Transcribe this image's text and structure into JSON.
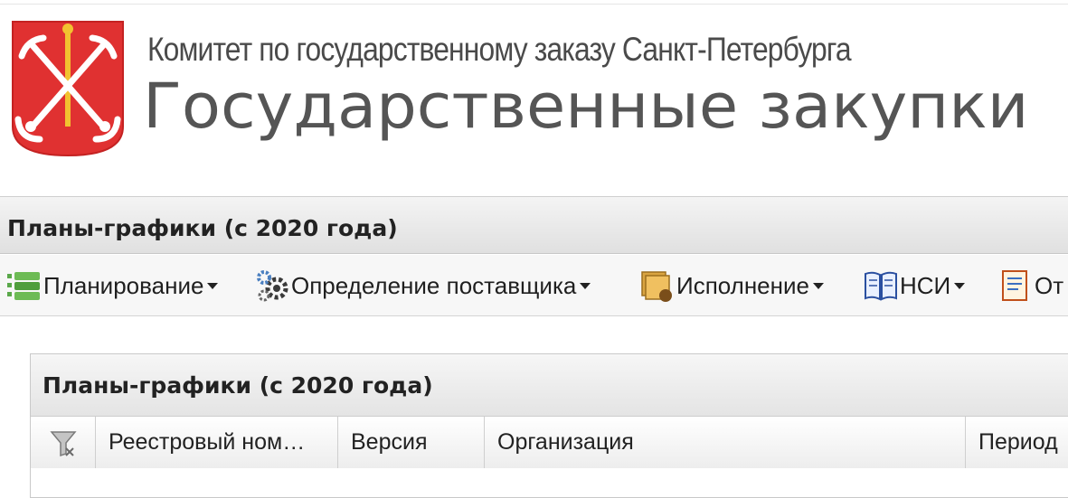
{
  "header": {
    "org_name": "Комитет по государственному заказу Санкт-Петербурга",
    "site_title": "Государственные закупки",
    "emblem": "saint-petersburg-coat-of-arms"
  },
  "section": {
    "title": "Планы-графики (с 2020 года)"
  },
  "menu": {
    "items": [
      {
        "label": "Планирование",
        "icon": "planning-icon"
      },
      {
        "label": "Определение поставщика",
        "icon": "gears-icon"
      },
      {
        "label": "Исполнение",
        "icon": "execution-icon"
      },
      {
        "label": "НСИ",
        "icon": "book-icon"
      },
      {
        "label": "От",
        "icon": "report-icon"
      }
    ]
  },
  "grid": {
    "title": "Планы-графики (с 2020 года)",
    "filter_icon": "filter-icon",
    "columns": [
      {
        "label": "Реестровый ном…"
      },
      {
        "label": "Версия"
      },
      {
        "label": "Организация"
      },
      {
        "label": "Период"
      }
    ]
  },
  "colors": {
    "emblem_red": "#e03131",
    "text_gray": "#555555"
  }
}
